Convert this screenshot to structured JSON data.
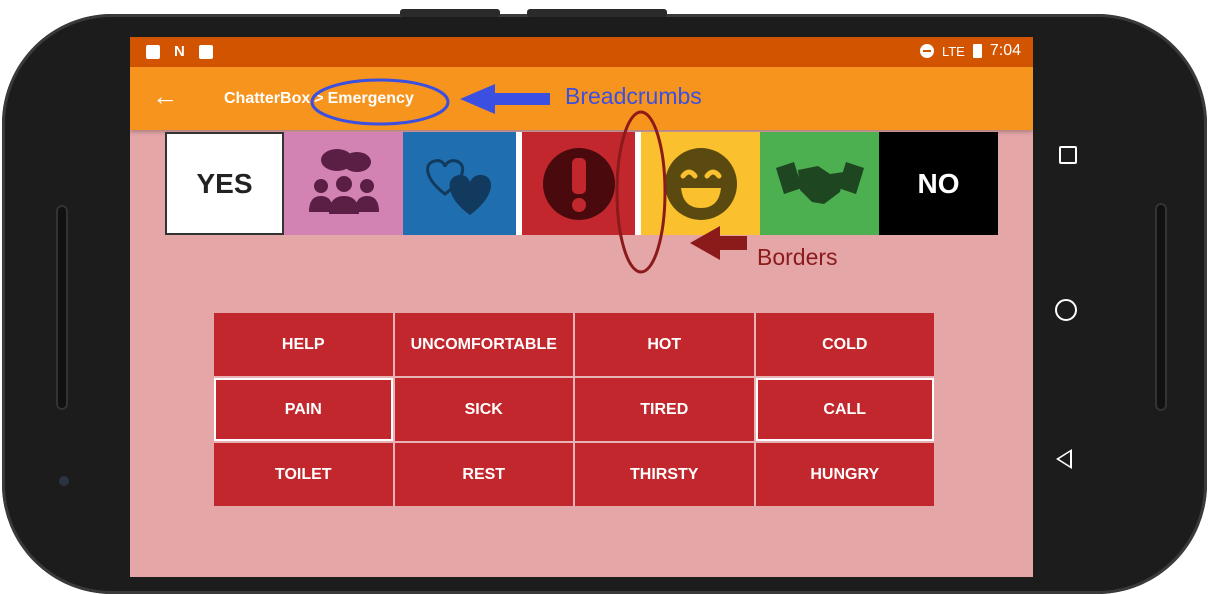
{
  "status_bar": {
    "time": "7:04",
    "signal_label": "LTE"
  },
  "app_bar": {
    "back_icon": "arrow-left",
    "breadcrumb": {
      "root": "ChatterBox",
      "separator": ">",
      "current": "Emergency"
    }
  },
  "category_tiles": [
    {
      "label": "YES",
      "icon": null
    },
    {
      "label": "",
      "icon": "people-talking-icon"
    },
    {
      "label": "",
      "icon": "hearts-icon"
    },
    {
      "label": "",
      "icon": "exclamation-icon"
    },
    {
      "label": "",
      "icon": "smiley-icon"
    },
    {
      "label": "",
      "icon": "handshake-icon"
    },
    {
      "label": "NO",
      "icon": null
    }
  ],
  "word_grid": {
    "rows": [
      [
        "HELP",
        "UNCOMFORTABLE",
        "HOT",
        "COLD"
      ],
      [
        "PAIN",
        "SICK",
        "TIRED",
        "CALL"
      ],
      [
        "TOILET",
        "REST",
        "THIRSTY",
        "HUNGRY"
      ]
    ]
  },
  "annotations": {
    "breadcrumbs_label": "Breadcrumbs",
    "borders_label": "Borders"
  },
  "colors": {
    "status_bar": "#d35400",
    "app_bar": "#f7941d",
    "screen_bg": "#e5a6a8",
    "grid_cell": "#c1272d",
    "annotation_blue": "#3b4fe0",
    "annotation_red": "#8b1a1a"
  }
}
